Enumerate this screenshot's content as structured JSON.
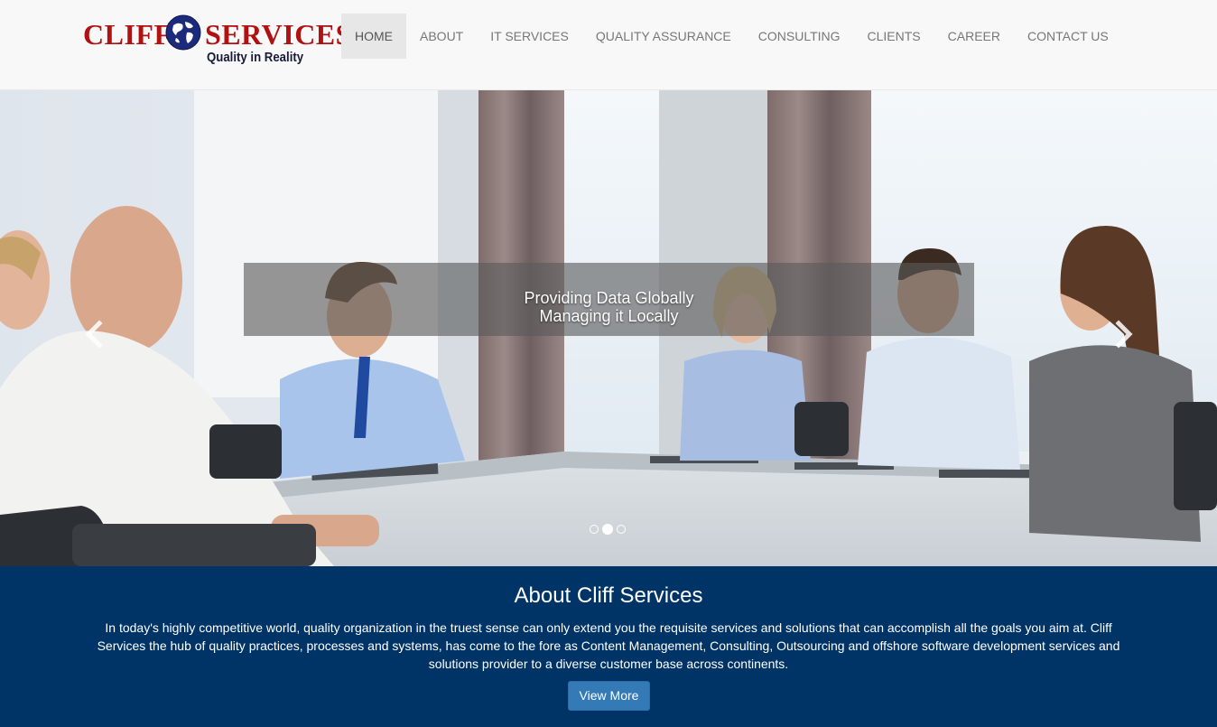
{
  "brand": {
    "name_left": "CLIFF",
    "name_right": "SERVICES",
    "tagline": "Quality in Reality",
    "colors": {
      "name": "#b01212",
      "globe": "#1b2a7a"
    }
  },
  "nav": {
    "items": [
      {
        "label": "HOME",
        "active": true
      },
      {
        "label": "ABOUT"
      },
      {
        "label": "IT SERVICES"
      },
      {
        "label": "QUALITY ASSURANCE"
      },
      {
        "label": "CONSULTING"
      },
      {
        "label": "CLIENTS"
      },
      {
        "label": "CAREER"
      },
      {
        "label": "CONTACT US"
      }
    ]
  },
  "carousel": {
    "caption_line1": "Providing Data Globally",
    "caption_line2": "Managing it Locally",
    "slide_count": 3,
    "active_slide": 2,
    "prev_icon": "chevron-left-icon",
    "next_icon": "chevron-right-icon"
  },
  "about": {
    "title": "About Cliff Services",
    "text": "In today's highly competitive world, quality organization in the truest sense can only extend you the requisite services and solutions that can accomplish all the goals you aim at. Cliff Services the hub of quality practices, processes and systems, has come to the fore as Content Management, Consulting, Outsourcing and offshore software development services and solutions provider to a diverse customer base across continents.",
    "button_label": "View More",
    "colors": {
      "background": "#003366",
      "button": "#337ab7"
    }
  }
}
